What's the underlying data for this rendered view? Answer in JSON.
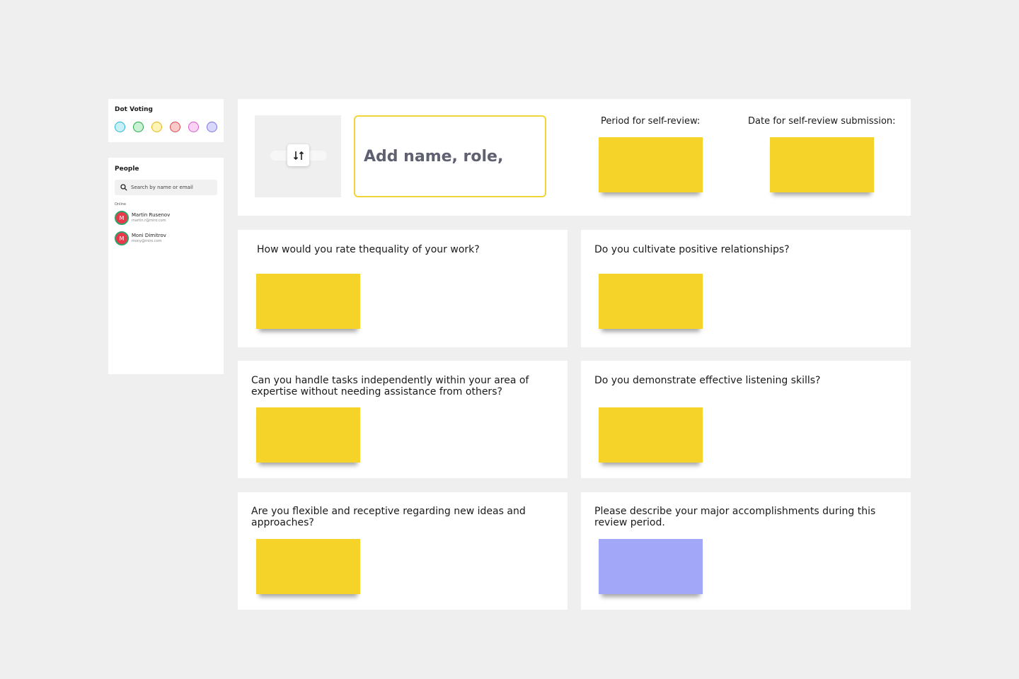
{
  "dot_voting": {
    "title": "Dot Voting",
    "dots": [
      {
        "name": "cyan",
        "fill": "#c8f0f7",
        "border": "#29b6d0"
      },
      {
        "name": "green",
        "fill": "#c9f2d4",
        "border": "#23a84a"
      },
      {
        "name": "yellow",
        "fill": "#fff3b5",
        "border": "#e3b714"
      },
      {
        "name": "red",
        "fill": "#f9c8c8",
        "border": "#d9484f"
      },
      {
        "name": "pink",
        "fill": "#f9d2f4",
        "border": "#d65bcb"
      },
      {
        "name": "purple",
        "fill": "#d9d7fb",
        "border": "#7b74e0"
      }
    ]
  },
  "people": {
    "title": "People",
    "search_placeholder": "Search by name or email",
    "online_label": "Online",
    "users": [
      {
        "initial": "M",
        "name": "Martin Rusenov",
        "email": "martin.r@miro.com"
      },
      {
        "initial": "M",
        "name": "Moni Dimitrov",
        "email": "mony@miro.com"
      }
    ]
  },
  "header": {
    "name_placeholder": "Add name, role,",
    "period_label": "Period for self-review:",
    "date_label": "Date for self-review submission:"
  },
  "questions": [
    {
      "text": "How would you rate thequality of your work?",
      "note_color": "yellow"
    },
    {
      "text": "Do you cultivate positive relationships?",
      "note_color": "yellow"
    },
    {
      "text": "Can you handle tasks independently within your area of expertise without needing assistance from others?",
      "note_color": "yellow"
    },
    {
      "text": "Do you demonstrate effective listening skills?",
      "note_color": "yellow"
    },
    {
      "text": "Are you flexible and receptive regarding new ideas and approaches?",
      "note_color": "yellow"
    },
    {
      "text": "Please describe your major accomplishments during this review period.",
      "note_color": "purple"
    }
  ],
  "colors": {
    "canvas": "#efefef",
    "sticky_yellow": "#f5d328",
    "sticky_purple": "#a2a7f8",
    "name_box_border": "#f0d53a"
  }
}
